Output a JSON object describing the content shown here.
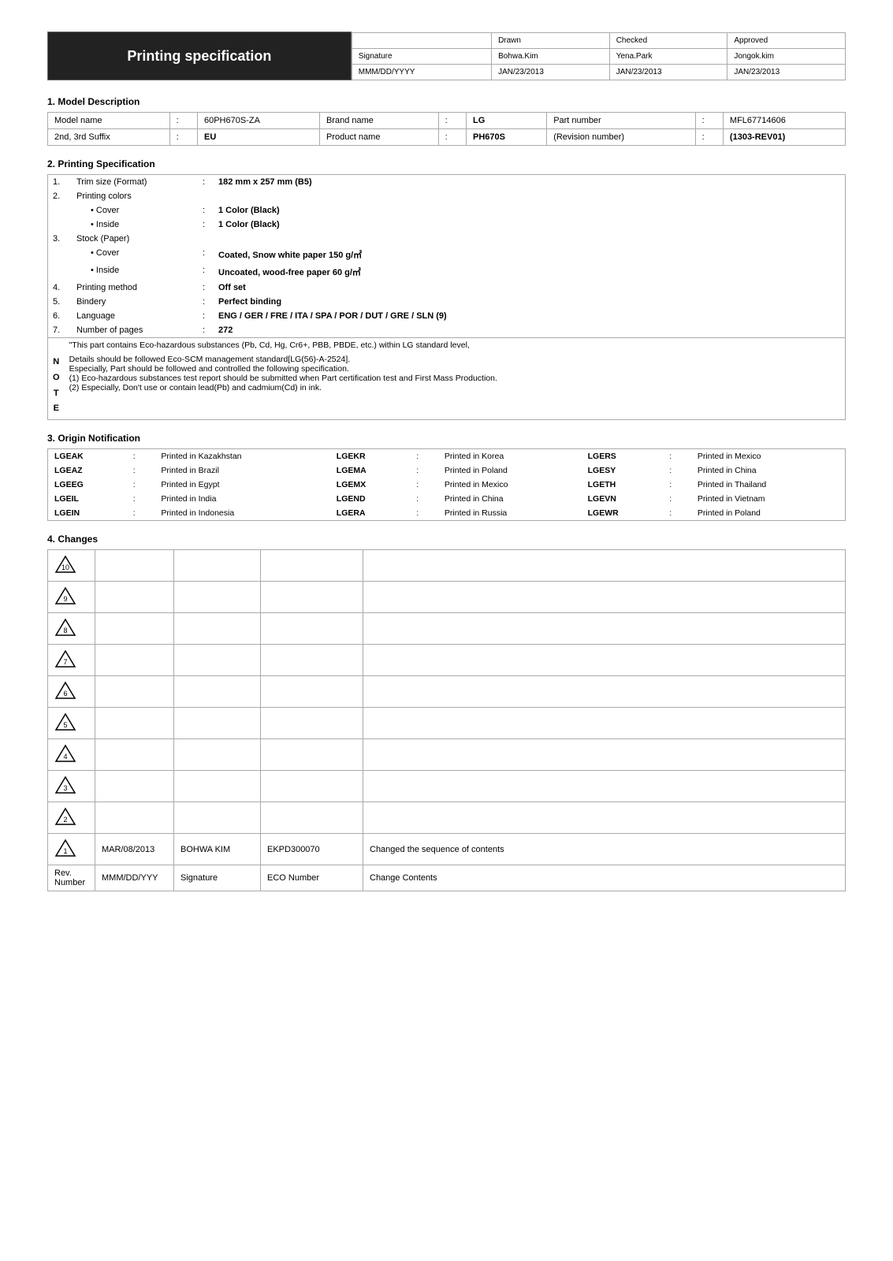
{
  "header": {
    "title": "Printing specification",
    "columns": [
      "",
      "Drawn",
      "Checked",
      "Approved"
    ],
    "rows": [
      [
        "Signature",
        "Bohwa.Kim",
        "Yena.Park",
        "Jongok.kim"
      ],
      [
        "MMM/DD/YYYY",
        "JAN/23/2013",
        "JAN/23/2013",
        "JAN/23/2013"
      ]
    ]
  },
  "section1": {
    "label": "1. Model Description",
    "fields": [
      {
        "label": "Model name",
        "sep": ":",
        "value": "60PH670S-ZA"
      },
      {
        "label": "Brand name",
        "sep": ":",
        "value": "LG"
      },
      {
        "label": "Part number",
        "sep": ":",
        "value": "MFL67714606"
      },
      {
        "label": "2nd, 3rd Suffix",
        "sep": ":",
        "value": "EU"
      },
      {
        "label": "Product name",
        "sep": ":",
        "value": "PH670S"
      },
      {
        "label": "(Revision number)",
        "sep": ":",
        "value": "(1303-REV01)"
      }
    ]
  },
  "section2": {
    "label": "2. Printing Specification",
    "items": [
      {
        "index": "1.",
        "label": "Trim size (Format)",
        "sep": ":",
        "value": "182 mm x 257 mm (B5)",
        "bold": true
      },
      {
        "index": "2.",
        "label": "Printing colors",
        "sep": "",
        "value": "",
        "bold": false
      },
      {
        "index": "",
        "label": "• Cover",
        "sep": ":",
        "value": "1 Color (Black)",
        "bold": true,
        "indent": 2
      },
      {
        "index": "",
        "label": "• Inside",
        "sep": ":",
        "value": "1 Color (Black)",
        "bold": true,
        "indent": 2
      },
      {
        "index": "3.",
        "label": "Stock (Paper)",
        "sep": "",
        "value": "",
        "bold": false
      },
      {
        "index": "",
        "label": "• Cover",
        "sep": ":",
        "value": "Coated, Snow white paper 150 g/㎡",
        "bold": true,
        "indent": 2
      },
      {
        "index": "",
        "label": "• Inside",
        "sep": ":",
        "value": "Uncoated, wood-free paper 60 g/㎡",
        "bold": true,
        "indent": 2
      },
      {
        "index": "4.",
        "label": "Printing method",
        "sep": ":",
        "value": "Off set",
        "bold": true
      },
      {
        "index": "5.",
        "label": "Bindery",
        "sep": ":",
        "value": "Perfect binding",
        "bold": true
      },
      {
        "index": "6.",
        "label": "Language",
        "sep": ":",
        "value": "ENG / GER / FRE / ITA / SPA / POR / DUT / GRE / SLN (9)",
        "bold": true
      },
      {
        "index": "7.",
        "label": "Number of pages",
        "sep": ":",
        "value": "272",
        "bold": true
      }
    ],
    "notes": {
      "intro": "\"This part contains Eco-hazardous substances (Pb, Cd, Hg, Cr6+, PBB, PBDE, etc.) within LG standard level,",
      "note_label": "N\nO\nT\nE",
      "note_lines": [
        "Details should be followed Eco-SCM management standard[LG(56)-A-2524].",
        "Especially, Part should be followed and controlled the following specification.",
        "(1) Eco-hazardous substances test report should be submitted when Part certification test and First Mass Production.",
        "(2) Especially, Don't use or contain lead(Pb) and cadmium(Cd) in ink."
      ]
    }
  },
  "section3": {
    "label": "3. Origin Notification",
    "entries": [
      [
        "LGEAK",
        "Printed in Kazakhstan",
        "LGEKR",
        "Printed in Korea",
        "LGERS",
        "Printed in Mexico"
      ],
      [
        "LGEAZ",
        "Printed in Brazil",
        "LGEMA",
        "Printed in Poland",
        "LGESY",
        "Printed in China"
      ],
      [
        "LGEEG",
        "Printed in Egypt",
        "LGEMX",
        "Printed in Mexico",
        "LGETH",
        "Printed in Thailand"
      ],
      [
        "LGEIL",
        "Printed in India",
        "LGEND",
        "Printed in China",
        "LGEVN",
        "Printed in Vietnam"
      ],
      [
        "LGEIN",
        "Printed in Indonesia",
        "LGERA",
        "Printed in Russia",
        "LGEWR",
        "Printed in Poland"
      ]
    ]
  },
  "section4": {
    "label": "4. Changes",
    "changes": [
      {
        "rev": "10",
        "date": "",
        "signature": "",
        "eco": "",
        "contents": ""
      },
      {
        "rev": "9",
        "date": "",
        "signature": "",
        "eco": "",
        "contents": ""
      },
      {
        "rev": "8",
        "date": "",
        "signature": "",
        "eco": "",
        "contents": ""
      },
      {
        "rev": "7",
        "date": "",
        "signature": "",
        "eco": "",
        "contents": ""
      },
      {
        "rev": "6",
        "date": "",
        "signature": "",
        "eco": "",
        "contents": ""
      },
      {
        "rev": "5",
        "date": "",
        "signature": "",
        "eco": "",
        "contents": ""
      },
      {
        "rev": "4",
        "date": "",
        "signature": "",
        "eco": "",
        "contents": ""
      },
      {
        "rev": "3",
        "date": "",
        "signature": "",
        "eco": "",
        "contents": ""
      },
      {
        "rev": "2",
        "date": "",
        "signature": "",
        "eco": "",
        "contents": ""
      },
      {
        "rev": "1",
        "date": "MAR/08/2013",
        "signature": "BOHWA KIM",
        "eco": "EKPD300070",
        "contents": "Changed the sequence of contents"
      }
    ],
    "footer_cols": [
      "Rev. Number",
      "MMM/DD/YYY",
      "Signature",
      "ECO Number",
      "Change Contents"
    ]
  }
}
